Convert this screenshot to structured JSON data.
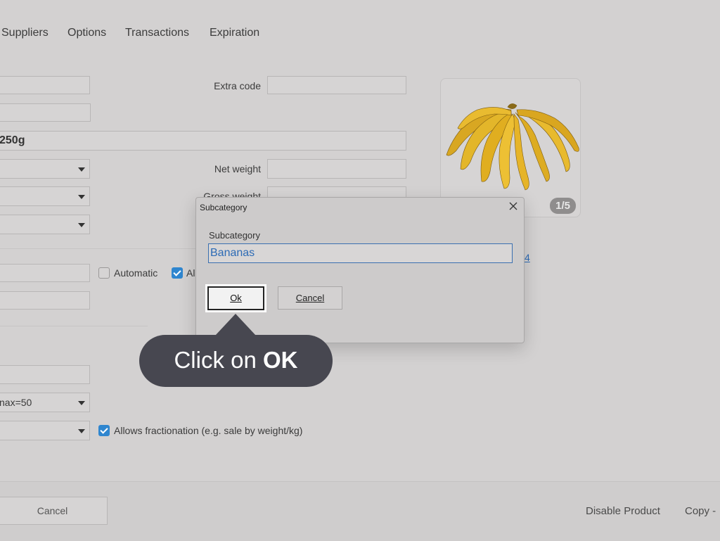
{
  "tabs": [
    "Suppliers",
    "Options",
    "Transactions",
    "Expiration"
  ],
  "form": {
    "extra_code_label": "Extra code",
    "name_value": "250g",
    "net_weight_label": "Net weight",
    "gross_weight_label": "Gross weight",
    "automatic_label": "Automatic",
    "allow_partial_label": "Al",
    "link_partial": "4",
    "stock_select_value": "nax=50",
    "fractionation_label": "Allows fractionation (e.g. sale by weight/kg)"
  },
  "image_card": {
    "counter": "1/5",
    "image_icon": "banana-bunch-image"
  },
  "footer": {
    "cancel_label": "Cancel",
    "disable_label": "Disable Product",
    "copy_label": "Copy -"
  },
  "dialog": {
    "title": "Subcategory",
    "field_label": "Subcategory",
    "field_value": "Bananas",
    "ok_label": "Ok",
    "cancel_label": "Cancel"
  },
  "tooltip": {
    "prefix": "Click on ",
    "bold": "OK"
  },
  "colors": {
    "accent": "#2f86cf",
    "tooltip_bg": "#474750",
    "input_text": "#2d6bb5"
  }
}
